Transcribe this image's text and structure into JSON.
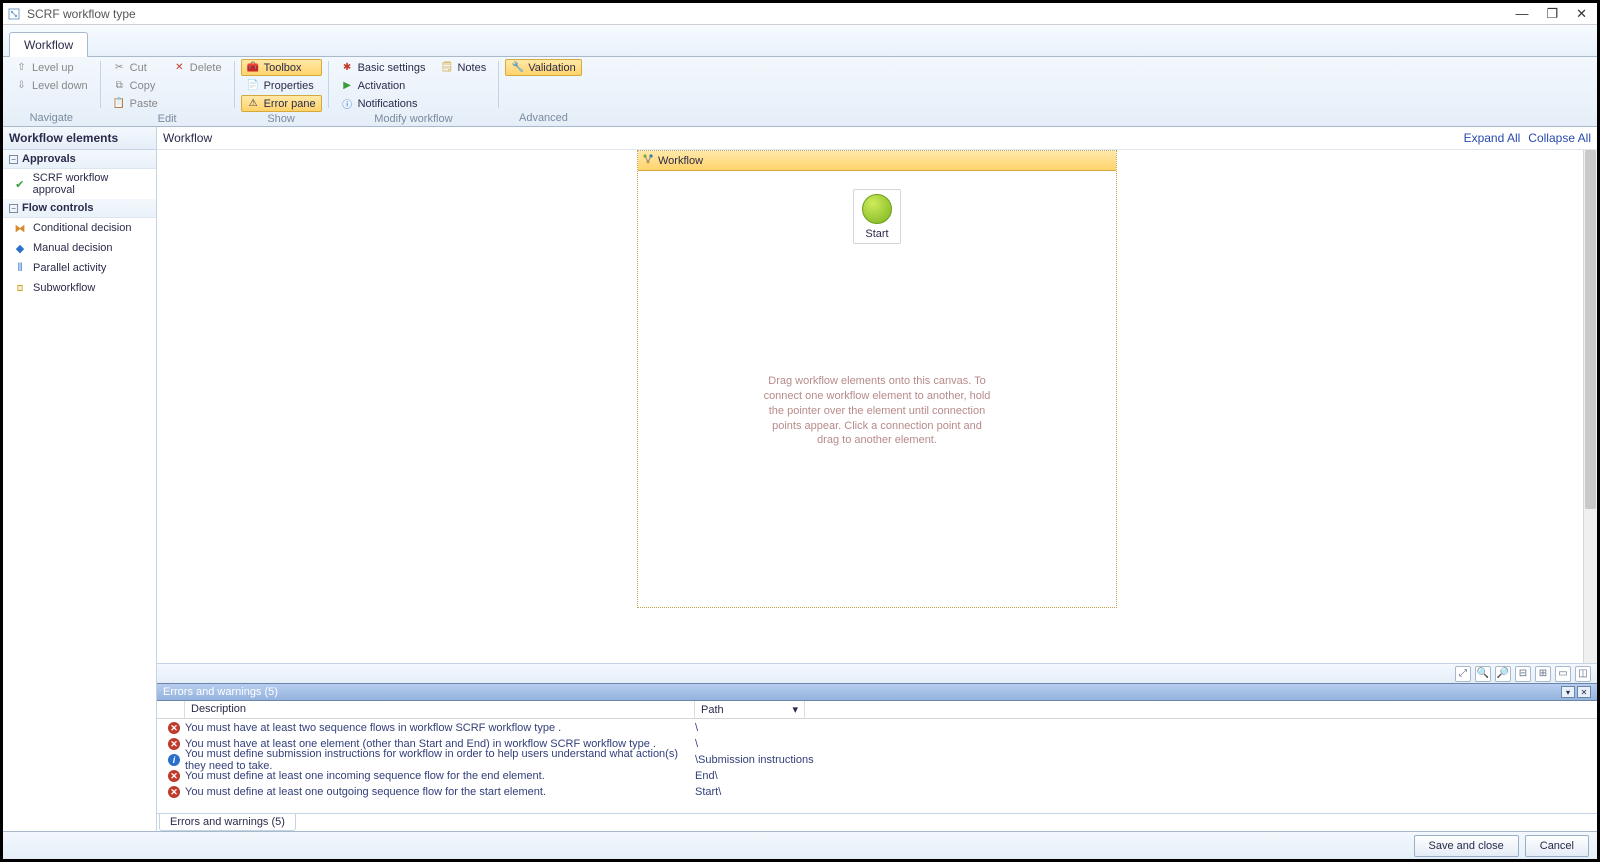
{
  "window": {
    "title": "SCRF workflow type"
  },
  "tabs": {
    "main": "Workflow"
  },
  "ribbon": {
    "navigate": {
      "label": "Navigate",
      "level_up": "Level up",
      "level_down": "Level down"
    },
    "edit": {
      "label": "Edit",
      "cut": "Cut",
      "copy": "Copy",
      "paste": "Paste",
      "delete": "Delete"
    },
    "show": {
      "label": "Show",
      "toolbox": "Toolbox",
      "properties": "Properties",
      "error_pane": "Error pane"
    },
    "modify": {
      "label": "Modify workflow",
      "basic_settings": "Basic settings",
      "activation": "Activation",
      "notifications": "Notifications",
      "notes": "Notes"
    },
    "advanced": {
      "label": "Advanced",
      "validation": "Validation"
    }
  },
  "sidebar": {
    "title": "Workflow elements",
    "groups": [
      {
        "header": "Approvals",
        "items": [
          "SCRF workflow approval"
        ]
      },
      {
        "header": "Flow controls",
        "items": [
          "Conditional decision",
          "Manual decision",
          "Parallel activity",
          "Subworkflow"
        ]
      }
    ]
  },
  "breadcrumb": {
    "path": "Workflow",
    "expand_all": "Expand All",
    "collapse_all": "Collapse All"
  },
  "canvas": {
    "workflow_title": "Workflow",
    "start_label": "Start",
    "hint": "Drag workflow elements onto this canvas. To connect one workflow element to another, hold the pointer over the element until connection points appear.  Click a connection point and drag to another element."
  },
  "error_pane": {
    "title": "Errors and warnings (5)",
    "headers": {
      "description": "Description",
      "path": "Path"
    },
    "rows": [
      {
        "type": "error",
        "desc": "You must have at least two sequence flows in workflow SCRF workflow type .",
        "path": "\\"
      },
      {
        "type": "error",
        "desc": "You must have at least one element (other than Start and End) in workflow SCRF workflow type .",
        "path": "\\"
      },
      {
        "type": "info",
        "desc": "You must define submission instructions for workflow  in order to help users understand what action(s) they need to take.",
        "path": "\\Submission instructions"
      },
      {
        "type": "error",
        "desc": "You must define at least one incoming sequence flow for the end element.",
        "path": "End\\"
      },
      {
        "type": "error",
        "desc": "You must define at least one outgoing sequence flow for the start element.",
        "path": "Start\\"
      }
    ],
    "tab": "Errors and warnings (5)"
  },
  "footer": {
    "save_close": "Save and close",
    "cancel": "Cancel"
  }
}
